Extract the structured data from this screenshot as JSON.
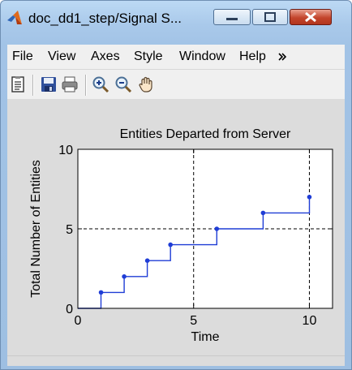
{
  "window": {
    "title": "doc_dd1_step/Signal S...",
    "accent": "#1f3dd6"
  },
  "menu": {
    "items": [
      "File",
      "View",
      "Axes",
      "Style",
      "Window",
      "Help"
    ]
  },
  "toolbar": {
    "tools": [
      "edit-plot-icon",
      "save-icon",
      "print-icon",
      "zoom-in-icon",
      "zoom-out-icon",
      "pan-hand-icon"
    ]
  },
  "chart_data": {
    "type": "line",
    "title": "Entities Departed from Server",
    "xlabel": "Time",
    "ylabel": "Total Number of Entities",
    "xlim": [
      0,
      11
    ],
    "ylim": [
      0,
      10
    ],
    "xticks": [
      0,
      5,
      10
    ],
    "yticks": [
      0,
      5,
      10
    ],
    "grid": "dashed",
    "step": true,
    "series": [
      {
        "x": [
          1,
          2,
          3,
          4,
          6,
          8,
          10
        ],
        "y": [
          1,
          2,
          3,
          4,
          5,
          6,
          7
        ],
        "color": "#1f3dd6"
      }
    ]
  }
}
